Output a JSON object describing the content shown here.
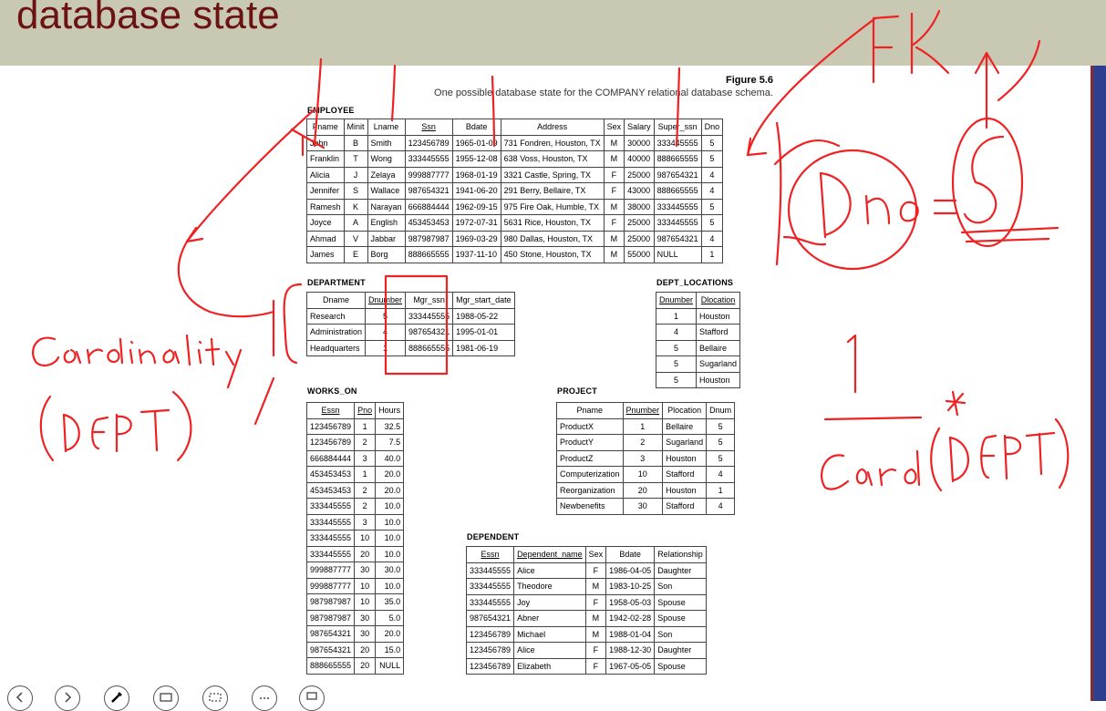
{
  "slide": {
    "title": "database state",
    "figure_number": "Figure 5.6",
    "figure_caption": "One possible database state for the COMPANY relational database schema."
  },
  "employee": {
    "label": "EMPLOYEE",
    "headers": [
      "Fname",
      "Minit",
      "Lname",
      "Ssn",
      "Bdate",
      "Address",
      "Sex",
      "Salary",
      "Super_ssn",
      "Dno"
    ],
    "rows": [
      [
        "John",
        "B",
        "Smith",
        "123456789",
        "1965-01-09",
        "731 Fondren, Houston, TX",
        "M",
        "30000",
        "333445555",
        "5"
      ],
      [
        "Franklin",
        "T",
        "Wong",
        "333445555",
        "1955-12-08",
        "638 Voss, Houston, TX",
        "M",
        "40000",
        "888665555",
        "5"
      ],
      [
        "Alicia",
        "J",
        "Zelaya",
        "999887777",
        "1968-01-19",
        "3321 Castle, Spring, TX",
        "F",
        "25000",
        "987654321",
        "4"
      ],
      [
        "Jennifer",
        "S",
        "Wallace",
        "987654321",
        "1941-06-20",
        "291 Berry, Bellaire, TX",
        "F",
        "43000",
        "888665555",
        "4"
      ],
      [
        "Ramesh",
        "K",
        "Narayan",
        "666884444",
        "1962-09-15",
        "975 Fire Oak, Humble, TX",
        "M",
        "38000",
        "333445555",
        "5"
      ],
      [
        "Joyce",
        "A",
        "English",
        "453453453",
        "1972-07-31",
        "5631 Rice, Houston, TX",
        "F",
        "25000",
        "333445555",
        "5"
      ],
      [
        "Ahmad",
        "V",
        "Jabbar",
        "987987987",
        "1969-03-29",
        "980 Dallas, Houston, TX",
        "M",
        "25000",
        "987654321",
        "4"
      ],
      [
        "James",
        "E",
        "Borg",
        "888665555",
        "1937-11-10",
        "450 Stone, Houston, TX",
        "M",
        "55000",
        "NULL",
        "1"
      ]
    ]
  },
  "department": {
    "label": "DEPARTMENT",
    "headers": [
      "Dname",
      "Dnumber",
      "Mgr_ssn",
      "Mgr_start_date"
    ],
    "rows": [
      [
        "Research",
        "5",
        "333445555",
        "1988-05-22"
      ],
      [
        "Administration",
        "4",
        "987654321",
        "1995-01-01"
      ],
      [
        "Headquarters",
        "1",
        "888665555",
        "1981-06-19"
      ]
    ]
  },
  "dept_locations": {
    "label": "DEPT_LOCATIONS",
    "headers": [
      "Dnumber",
      "Dlocation"
    ],
    "rows": [
      [
        "1",
        "Houston"
      ],
      [
        "4",
        "Stafford"
      ],
      [
        "5",
        "Bellaire"
      ],
      [
        "5",
        "Sugarland"
      ],
      [
        "5",
        "Houston"
      ]
    ]
  },
  "works_on": {
    "label": "WORKS_ON",
    "headers": [
      "Essn",
      "Pno",
      "Hours"
    ],
    "rows": [
      [
        "123456789",
        "1",
        "32.5"
      ],
      [
        "123456789",
        "2",
        "7.5"
      ],
      [
        "666884444",
        "3",
        "40.0"
      ],
      [
        "453453453",
        "1",
        "20.0"
      ],
      [
        "453453453",
        "2",
        "20.0"
      ],
      [
        "333445555",
        "2",
        "10.0"
      ],
      [
        "333445555",
        "3",
        "10.0"
      ],
      [
        "333445555",
        "10",
        "10.0"
      ],
      [
        "333445555",
        "20",
        "10.0"
      ],
      [
        "999887777",
        "30",
        "30.0"
      ],
      [
        "999887777",
        "10",
        "10.0"
      ],
      [
        "987987987",
        "10",
        "35.0"
      ],
      [
        "987987987",
        "30",
        "5.0"
      ],
      [
        "987654321",
        "30",
        "20.0"
      ],
      [
        "987654321",
        "20",
        "15.0"
      ],
      [
        "888665555",
        "20",
        "NULL"
      ]
    ]
  },
  "project": {
    "label": "PROJECT",
    "headers": [
      "Pname",
      "Pnumber",
      "Plocation",
      "Dnum"
    ],
    "rows": [
      [
        "ProductX",
        "1",
        "Bellaire",
        "5"
      ],
      [
        "ProductY",
        "2",
        "Sugarland",
        "5"
      ],
      [
        "ProductZ",
        "3",
        "Houston",
        "5"
      ],
      [
        "Computerization",
        "10",
        "Stafford",
        "4"
      ],
      [
        "Reorganization",
        "20",
        "Houston",
        "1"
      ],
      [
        "Newbenefits",
        "30",
        "Stafford",
        "4"
      ]
    ]
  },
  "dependent": {
    "label": "DEPENDENT",
    "headers": [
      "Essn",
      "Dependent_name",
      "Sex",
      "Bdate",
      "Relationship"
    ],
    "rows": [
      [
        "333445555",
        "Alice",
        "F",
        "1986-04-05",
        "Daughter"
      ],
      [
        "333445555",
        "Theodore",
        "M",
        "1983-10-25",
        "Son"
      ],
      [
        "333445555",
        "Joy",
        "F",
        "1958-05-03",
        "Spouse"
      ],
      [
        "987654321",
        "Abner",
        "M",
        "1942-02-28",
        "Spouse"
      ],
      [
        "123456789",
        "Michael",
        "M",
        "1988-01-04",
        "Son"
      ],
      [
        "123456789",
        "Alice",
        "F",
        "1988-12-30",
        "Daughter"
      ],
      [
        "123456789",
        "Elizabeth",
        "F",
        "1967-05-05",
        "Spouse"
      ]
    ]
  },
  "annotations": {
    "fk": "FK",
    "dno_eq": "Dno=5",
    "cardinality": "Cardinality",
    "dept_paren": "(DEPT)",
    "one": "1",
    "star": "*",
    "card_dept": "Card (DEPT)",
    "ink_color": "#ee2222"
  },
  "toolbar": {
    "icons": [
      "previous-icon",
      "next-icon",
      "pen-icon",
      "laser-icon",
      "eraser-icon",
      "more-icon",
      "screen-icon"
    ]
  }
}
